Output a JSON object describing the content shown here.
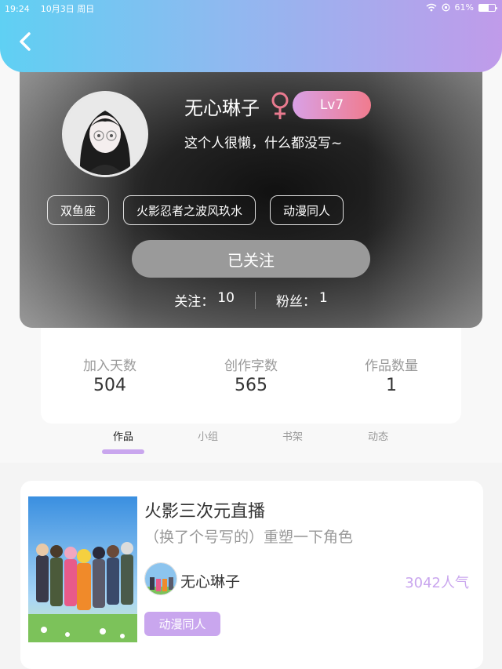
{
  "status_bar": {
    "time": "19:24",
    "date": "10月3日 周日",
    "battery_percent": "61%",
    "battery_level": 0.61
  },
  "header": {
    "back_icon": "chevron-left-icon",
    "gradient": [
      "#5fd0f3",
      "#c09bea"
    ]
  },
  "profile": {
    "nickname": "无心琳子",
    "gender_icon": "female-icon",
    "level": "Lv7",
    "signature": "这个人很懒，什么都没写~",
    "tags": [
      "双鱼座",
      "火影忍者之波风玖水",
      "动漫同人"
    ],
    "follow_button": "已关注",
    "following_label": "关注：",
    "following_count": "10",
    "fans_label": "粉丝：",
    "fans_count": "1"
  },
  "stats": [
    {
      "label": "加入天数",
      "value": "504"
    },
    {
      "label": "创作字数",
      "value": "565"
    },
    {
      "label": "作品数量",
      "value": "1"
    }
  ],
  "tabs": [
    {
      "label": "作品",
      "active": true
    },
    {
      "label": "小组",
      "active": false
    },
    {
      "label": "书架",
      "active": false
    },
    {
      "label": "动态",
      "active": false
    }
  ],
  "work": {
    "title": "火影三次元直播",
    "description": "（换了个号写的）重塑一下角色",
    "author": "无心琳子",
    "popularity": "3042人气",
    "tag": "动漫同人"
  },
  "colors": {
    "accent": "#c9a6ee",
    "level_badge": "#f07b8e"
  }
}
